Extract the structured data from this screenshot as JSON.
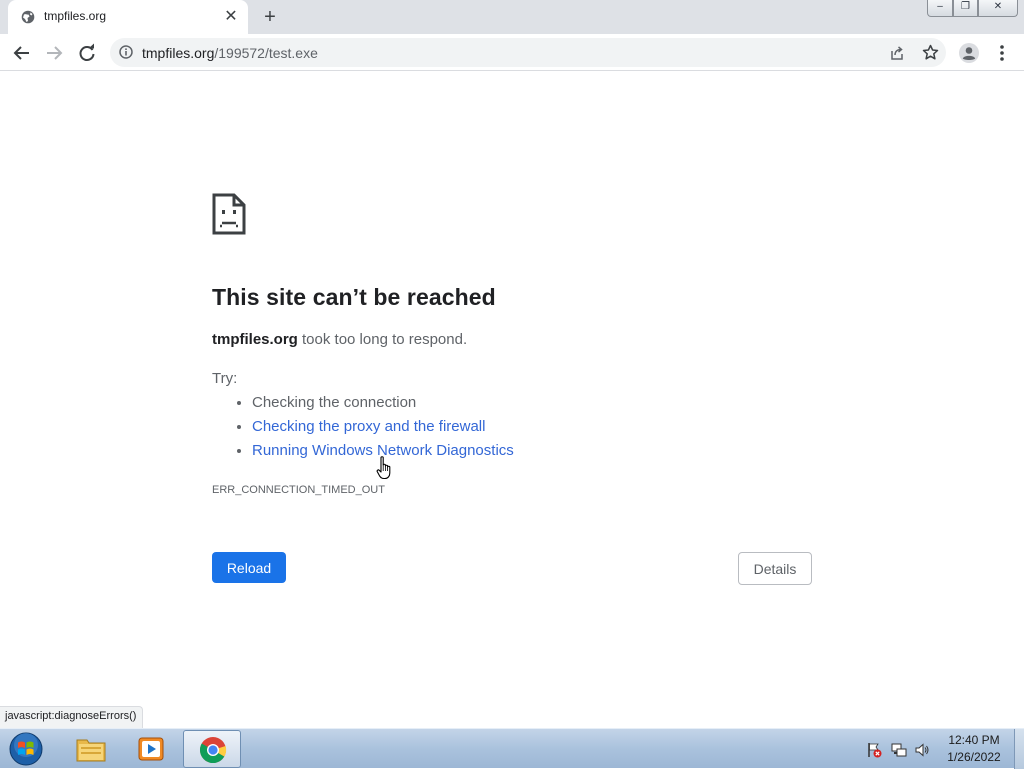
{
  "tab": {
    "title": "tmpfiles.org",
    "close_glyph": "✕",
    "favicon": "globe-icon"
  },
  "tabstrip": {
    "new_tab_glyph": "+"
  },
  "window_controls": {
    "minimize": "–",
    "maximize": "❐",
    "close": "✕"
  },
  "address_bar": {
    "host": "tmpfiles.org",
    "path": "/199572/test.exe"
  },
  "error": {
    "heading": "This site can’t be reached",
    "site": "tmpfiles.org",
    "message": " took too long to respond.",
    "try_label": "Try:",
    "suggestions": [
      "Checking the connection",
      "Checking the proxy and the firewall",
      "Running Windows Network Diagnostics"
    ],
    "code": "ERR_CONNECTION_TIMED_OUT",
    "reload_label": "Reload",
    "details_label": "Details"
  },
  "status_bar": {
    "text": "javascript:diagnoseErrors()"
  },
  "taskbar": {
    "items": [
      "start-orb",
      "file-explorer",
      "media-player",
      "chrome"
    ],
    "clock_time": "12:40 PM",
    "clock_date": "1/26/2022"
  },
  "colors": {
    "link": "#3367d6",
    "button_blue": "#1a73e8",
    "tab_strip": "#dee1e6"
  }
}
